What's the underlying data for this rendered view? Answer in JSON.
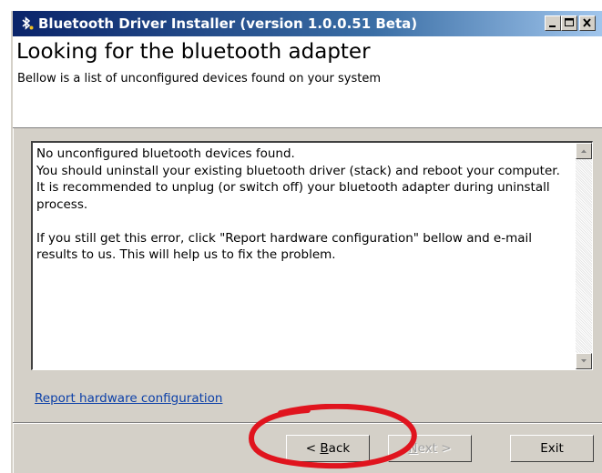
{
  "window": {
    "title": "Bluetooth Driver Installer (version 1.0.0.51 Beta)",
    "icon": "bluetooth-icon"
  },
  "header": {
    "title": "Looking for the bluetooth adapter",
    "subtitle": "Bellow is a list of unconfigured devices found on your system"
  },
  "message": {
    "line1": "No unconfigured bluetooth devices found.",
    "line2": "You should uninstall your existing bluetooth driver (stack) and reboot your computer.",
    "line3": "It is recommended to unplug (or switch off) your bluetooth adapter during uninstall process.",
    "line4": "If you still get this error, click \"Report hardware configuration\" bellow and e-mail results to us. This will help us to fix the problem."
  },
  "link": {
    "report": "Report hardware configuration"
  },
  "buttons": {
    "back_prefix": "< ",
    "back_key": "B",
    "back_rest": "ack",
    "next_key": "N",
    "next_rest": "ext >",
    "exit": "Exit"
  },
  "colors": {
    "annotation": "#e0141e",
    "link": "#0b3fa8",
    "titlebar_start": "#0a246a"
  }
}
